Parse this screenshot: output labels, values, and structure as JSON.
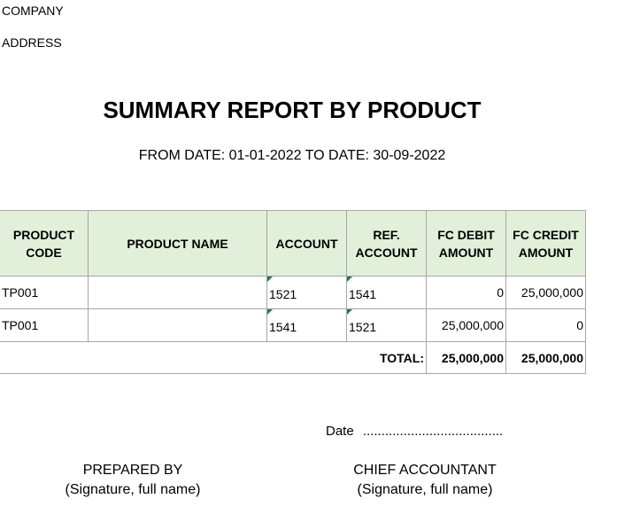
{
  "header": {
    "company": "COMPANY",
    "address": "ADDRESS",
    "title": "SUMMARY REPORT BY PRODUCT",
    "date_range": "FROM DATE: 01-01-2022 TO DATE: 30-09-2022"
  },
  "table": {
    "columns": [
      {
        "line1": "PRODUCT",
        "line2": "CODE"
      },
      {
        "line1": "PRODUCT NAME",
        "line2": ""
      },
      {
        "line1": "ACCOUNT",
        "line2": ""
      },
      {
        "line1": "REF.",
        "line2": "ACCOUNT"
      },
      {
        "line1": "FC DEBIT",
        "line2": "AMOUNT"
      },
      {
        "line1": "FC CREDIT",
        "line2": "AMOUNT"
      }
    ],
    "rows": [
      {
        "code": "TP001",
        "name": "",
        "account": "1521",
        "ref_account": "1541",
        "debit": "0",
        "credit": "25,000,000"
      },
      {
        "code": "TP001",
        "name": "",
        "account": "1541",
        "ref_account": "1521",
        "debit": "25,000,000",
        "credit": "0"
      }
    ],
    "total": {
      "label": "TOTAL:",
      "debit": "25,000,000",
      "credit": "25,000,000"
    },
    "header_color": "#e2f0d9",
    "marker_color": "#1e7f37"
  },
  "footer": {
    "date_label": "Date",
    "date_dots": "......................................",
    "prepared_by": "PREPARED BY",
    "prepared_sig": "(Signature, full name)",
    "chief_accountant": "CHIEF ACCOUNTANT",
    "chief_sig": "(Signature, full name)"
  }
}
